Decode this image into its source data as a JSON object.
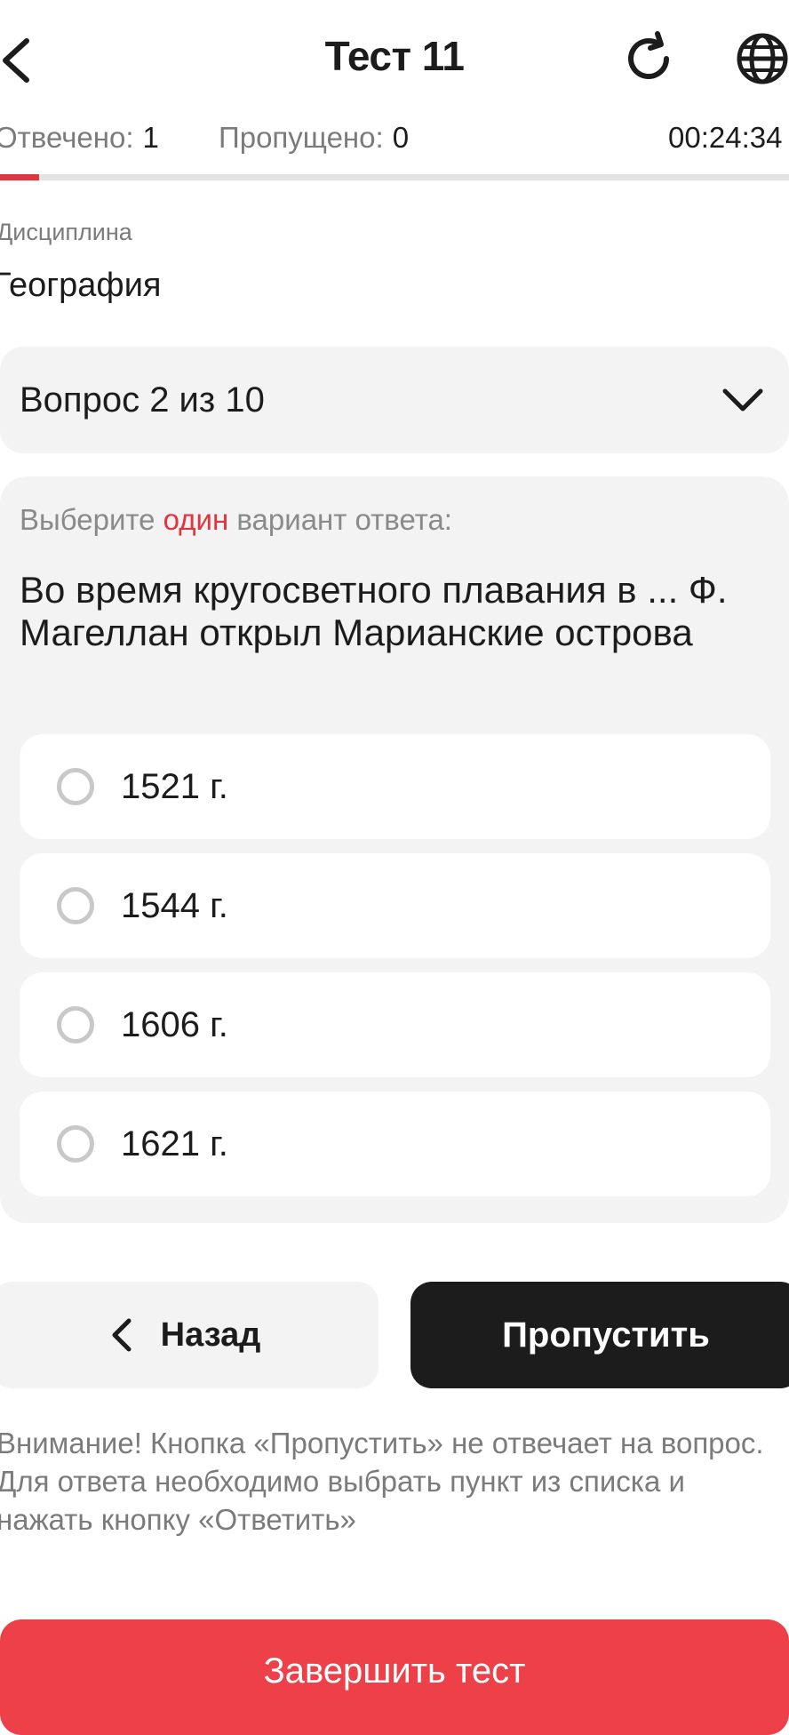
{
  "header": {
    "title": "Тест 11",
    "back_icon": "chevron-left-icon",
    "refresh_icon": "refresh-icon",
    "language_icon": "globe-icon"
  },
  "stats": {
    "answered_label": "Отвечено:",
    "answered_value": "1",
    "skipped_label": "Пропущено:",
    "skipped_value": "0",
    "timer": "00:24:34",
    "progress_fraction": 0.05
  },
  "discipline": {
    "label": "Дисциплина",
    "value": "География"
  },
  "question_selector": {
    "text": "Вопрос 2 из 10"
  },
  "question": {
    "instruction_prefix": "Выберите",
    "instruction_accent": "один",
    "instruction_suffix": "вариант ответа:",
    "text": "Во время кругосветного плавания в ... Ф. Магеллан открыл Марианские острова",
    "options": [
      {
        "label": "1521 г."
      },
      {
        "label": "1544 г."
      },
      {
        "label": "1606 г."
      },
      {
        "label": "1621 г."
      }
    ]
  },
  "actions": {
    "back_label": "Назад",
    "skip_label": "Пропустить",
    "finish_label": "Завершить тест"
  },
  "warning": "Внимание! Кнопка «Пропустить» не отвечает на вопрос. Для ответа необходимо выбрать пункт из списка и нажать кнопку «Ответить»",
  "colors": {
    "accent": "#e2343f",
    "finish_button": "#ee4049",
    "skip_button": "#1c1c1c",
    "panel": "#f3f3f4"
  }
}
